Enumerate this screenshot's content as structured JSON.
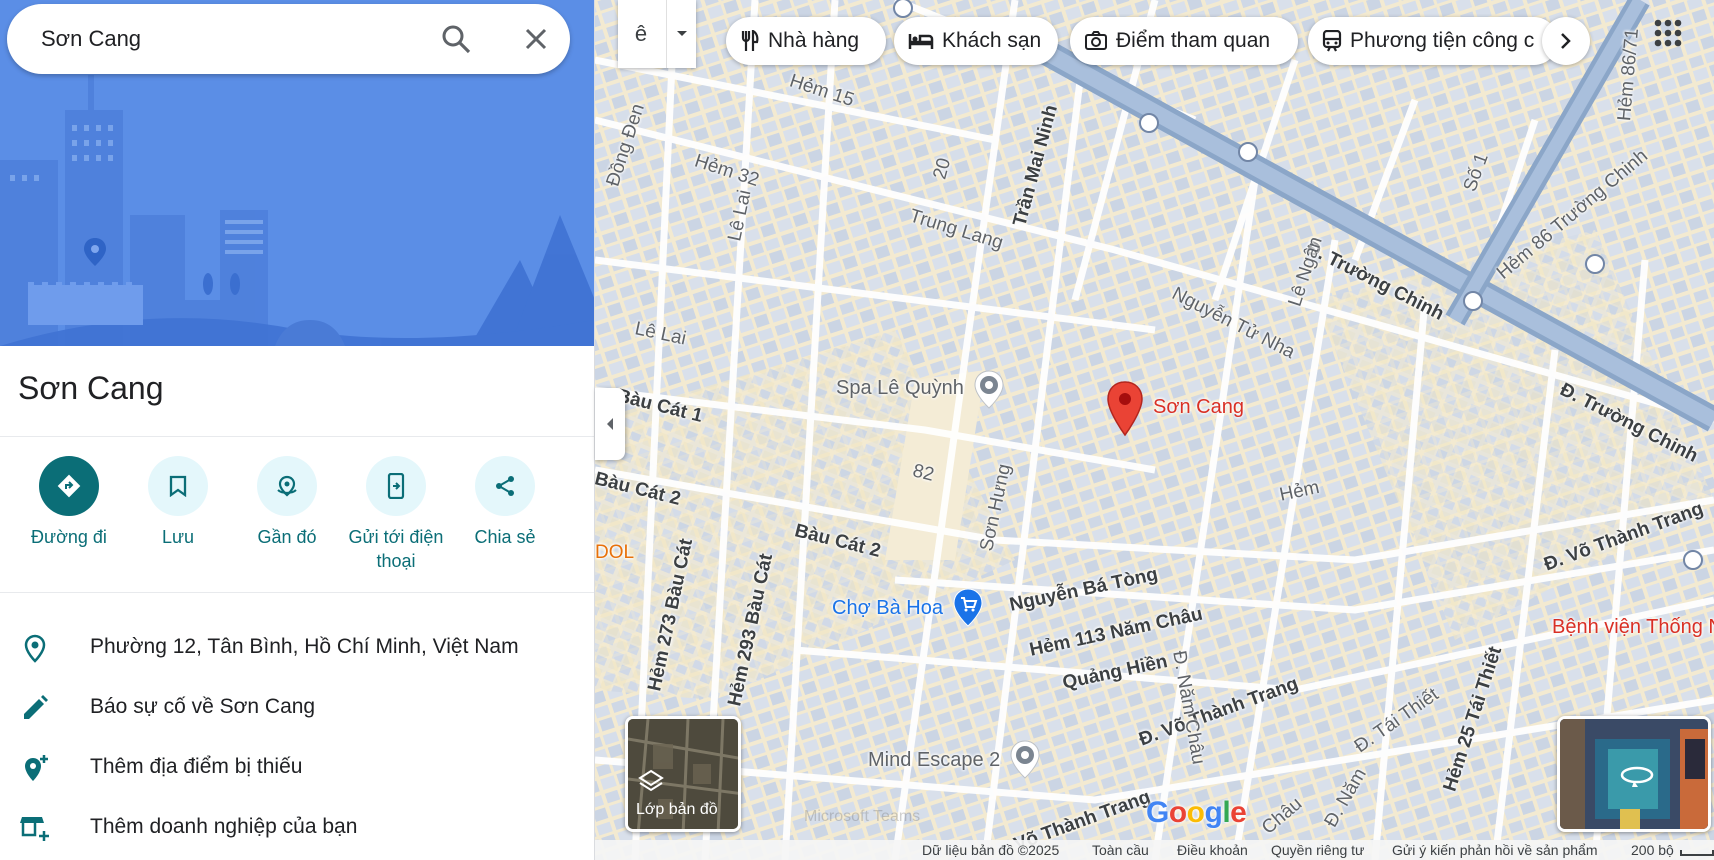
{
  "search": {
    "value": "Sơn Cang"
  },
  "place": {
    "title": "Sơn Cang"
  },
  "actions": [
    {
      "label": "Đường đi",
      "icon": "directions-icon"
    },
    {
      "label": "Lưu",
      "icon": "bookmark-icon"
    },
    {
      "label": "Gần đó",
      "icon": "nearby-icon"
    },
    {
      "label": "Gửi tới điện thoại",
      "icon": "send-to-phone-icon"
    },
    {
      "label": "Chia sẻ",
      "icon": "share-icon"
    }
  ],
  "info": [
    {
      "text": "Phường 12, Tân Bình, Hồ Chí Minh, Việt Nam",
      "icon": "location-pin-icon"
    },
    {
      "text": "Báo sự cố về Sơn Cang",
      "icon": "pencil-icon"
    },
    {
      "text": "Thêm địa điểm bị thiếu",
      "icon": "add-location-icon"
    },
    {
      "text": "Thêm doanh nghiệp của bạn",
      "icon": "add-business-icon"
    }
  ],
  "ime": {
    "label": "ê"
  },
  "chips": [
    {
      "label": "Nhà hàng",
      "icon": "restaurant-icon"
    },
    {
      "label": "Khách sạn",
      "icon": "hotel-icon"
    },
    {
      "label": "Điểm tham quan",
      "icon": "camera-icon"
    },
    {
      "label": "Phương tiện công c",
      "icon": "transit-icon"
    }
  ],
  "map": {
    "roads": {
      "truong_chinh_1": "Đ. Trường Chinh",
      "truong_chinh_2": "Đ. Trường Chinh",
      "hem15": "Hẻm 15",
      "dong_den": "Đồng Đen",
      "hem32": "Hẻm 32",
      "le_lai_1": "Lê Lai",
      "le_lai_2": "Lê Lai",
      "n20": "20",
      "trung_lang": "Trung Lang",
      "tran_mai_ninh": "Trần Mai Ninh",
      "nguyen_tu_nha": "Nguyễn Tử Nha",
      "le_ngan": "Lê Ngân",
      "hem86_tc": "Hẻm 86 Trường Chinh",
      "so1": "Số 1",
      "hem86_71": "Hẻm 86/71",
      "bau_cat1": "Bàu Cát 1",
      "bau_cat2_a": "Bàu Cát 2",
      "bau_cat2_b": "Bàu Cát 2",
      "n82": "82",
      "son_hung": "Sơn Hưng",
      "hem_right": "Hẻm",
      "vo_thanh_trang_1": "Đ. Võ Thành Trang",
      "vo_thanh_trang_2": "Đ. Võ Thành Trang",
      "vo_thanh_trang_3": "Võ Thành Trang",
      "nguyen_ba_tong": "Nguyễn Bá Tòng",
      "nam_chau": "Đ. Năm Châu",
      "hem113": "Hẻm 113 Năm Châu",
      "quang_hien": "Quảng Hiền",
      "hem273": "Hẻm 273 Bàu Cát",
      "hem293": "Hẻm 293 Bàu Cát",
      "tai_thiet": "Đ. Tái Thiết",
      "hem25": "Hẻm 25 Tái Thiết",
      "chau": "Châu",
      "nam": "Đ. Năm",
      "dool": "DOL"
    },
    "pois": {
      "spa": "Spa Lê Quỳnh",
      "marker": "Sơn Cang",
      "cho": "Chợ Bà Hoa",
      "hospital": "Bệnh viện Thống N",
      "mind": "Mind Escape 2"
    },
    "layer_label": "Lớp bản đồ",
    "google": "Google",
    "watermark": "Microsoft Teams"
  },
  "footer": {
    "data": "Dữ liệu bản đồ ©2025",
    "global": "Toàn cầu",
    "terms": "Điều khoản",
    "privacy": "Quyền riêng tư",
    "feedback": "Gửi ý kiến phản hồi về sản phẩm",
    "scale": "200 bộ"
  },
  "colors": {
    "accent": "#0b6e77",
    "accent_light": "#e4f7fb",
    "hero_bg": "#5b8ee6",
    "map_bg": "#f3ead1",
    "block": "#cfd8e6",
    "road": "#ffffff",
    "highway": "#8ba6c8",
    "pin": "#ea4335"
  }
}
